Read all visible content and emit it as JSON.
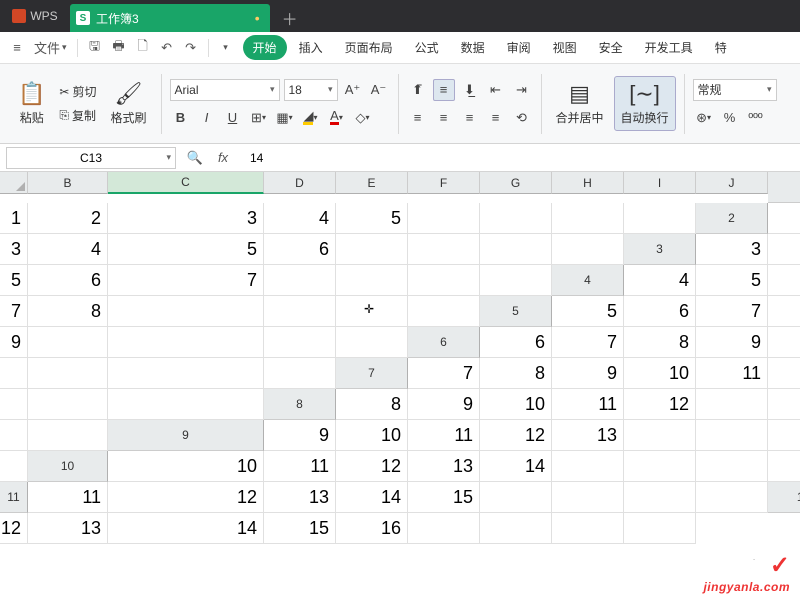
{
  "title_bar": {
    "wps": "WPS",
    "tab_name": "工作簿3",
    "tab_icon": "S"
  },
  "menu": {
    "file": "文件",
    "tabs": [
      "开始",
      "插入",
      "页面布局",
      "公式",
      "数据",
      "审阅",
      "视图",
      "安全",
      "开发工具",
      "特"
    ]
  },
  "ribbon": {
    "paste": "粘贴",
    "cut": "剪切",
    "copy": "复制",
    "format_painter": "格式刷",
    "font_name": "Arial",
    "font_size": "18",
    "merge": "合并居中",
    "wrap": "自动换行",
    "number_format": "常规"
  },
  "namebox": {
    "cell_ref": "C13",
    "formula_value": "14"
  },
  "columns": [
    "B",
    "C",
    "D",
    "E",
    "F",
    "G",
    "H",
    "I",
    "J"
  ],
  "selected_col_index": 1,
  "chart_data": {
    "type": "table",
    "columns": [
      "B",
      "C",
      "D",
      "E",
      "F"
    ],
    "rows": [
      [
        1,
        2,
        3,
        4,
        5
      ],
      [
        2,
        3,
        4,
        5,
        6
      ],
      [
        3,
        4,
        5,
        6,
        7
      ],
      [
        4,
        5,
        6,
        7,
        8
      ],
      [
        5,
        6,
        7,
        8,
        9
      ],
      [
        6,
        7,
        8,
        9,
        10
      ],
      [
        7,
        8,
        9,
        10,
        11
      ],
      [
        8,
        9,
        10,
        11,
        12
      ],
      [
        9,
        10,
        11,
        12,
        13
      ],
      [
        10,
        11,
        12,
        13,
        14
      ],
      [
        11,
        12,
        13,
        14,
        15
      ],
      [
        12,
        13,
        14,
        15,
        16
      ]
    ]
  },
  "watermark": {
    "cn": "经验啦",
    "en": "jingyanla.com"
  }
}
